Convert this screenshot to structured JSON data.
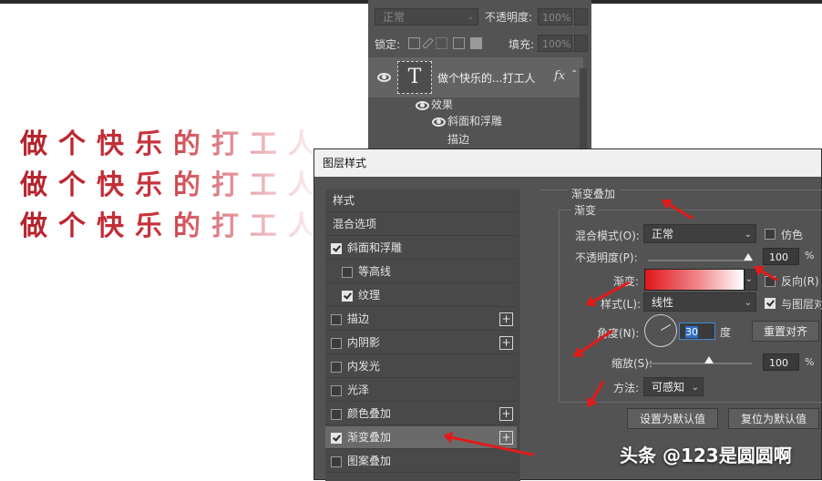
{
  "canvas": {
    "rows": [
      "做个快乐的打工人",
      "做个快乐的打工人",
      "做个快乐的打工人"
    ]
  },
  "layers_panel": {
    "blend_mode": "正常",
    "opacity_label": "不透明度:",
    "opacity_value": "100%",
    "lock_label": "锁定:",
    "fill_label": "填充:",
    "fill_value": "100%",
    "layer_name": "做个快乐的...打工人",
    "thumb_glyph": "T",
    "fx_label": "fx",
    "effects_label": "效果",
    "effect_items": [
      "斜面和浮雕",
      "描边"
    ]
  },
  "dialog": {
    "title": "图层样式",
    "style_list": [
      {
        "label": "样式",
        "checkbox": false,
        "checked": false,
        "plus": false,
        "active": false,
        "indent": false
      },
      {
        "label": "混合选项",
        "checkbox": false,
        "checked": false,
        "plus": false,
        "active": false,
        "indent": false
      },
      {
        "label": "斜面和浮雕",
        "checkbox": true,
        "checked": true,
        "plus": false,
        "active": false,
        "indent": false
      },
      {
        "label": "等高线",
        "checkbox": true,
        "checked": false,
        "plus": false,
        "active": false,
        "indent": true
      },
      {
        "label": "纹理",
        "checkbox": true,
        "checked": true,
        "plus": false,
        "active": false,
        "indent": true
      },
      {
        "label": "描边",
        "checkbox": true,
        "checked": false,
        "plus": true,
        "active": false,
        "indent": false
      },
      {
        "label": "内阴影",
        "checkbox": true,
        "checked": false,
        "plus": true,
        "active": false,
        "indent": false
      },
      {
        "label": "内发光",
        "checkbox": true,
        "checked": false,
        "plus": false,
        "active": false,
        "indent": false
      },
      {
        "label": "光泽",
        "checkbox": true,
        "checked": false,
        "plus": false,
        "active": false,
        "indent": false
      },
      {
        "label": "颜色叠加",
        "checkbox": true,
        "checked": false,
        "plus": true,
        "active": false,
        "indent": false
      },
      {
        "label": "渐变叠加",
        "checkbox": true,
        "checked": true,
        "plus": true,
        "active": true,
        "indent": false
      },
      {
        "label": "图案叠加",
        "checkbox": true,
        "checked": false,
        "plus": false,
        "active": false,
        "indent": false
      }
    ],
    "section_title": "渐变叠加",
    "group_title": "渐变",
    "blend_label": "混合模式(O):",
    "blend_value": "正常",
    "dither_label": "仿色",
    "opacity_label": "不透明度(P):",
    "opacity_value": "100",
    "percent": "%",
    "gradient_label": "渐变:",
    "reverse_label": "反向(R)",
    "style_label": "样式(L):",
    "style_value": "线性",
    "align_label": "与图层对齐",
    "angle_label": "角度(N):",
    "angle_value": "30",
    "degree_label": "度",
    "reset_align_button": "重置对齐",
    "scale_label": "缩放(S):",
    "scale_value": "100",
    "method_label": "方法:",
    "method_value": "可感知",
    "set_default_button": "设置为默认值",
    "reset_default_button": "复位为默认值"
  },
  "watermark": "头条 @123是圆圆啊",
  "colors": {
    "gradient_start": "#e0161c",
    "gradient_end": "#ffffff",
    "arrow": "#e41a1a",
    "panel": "#535353"
  }
}
